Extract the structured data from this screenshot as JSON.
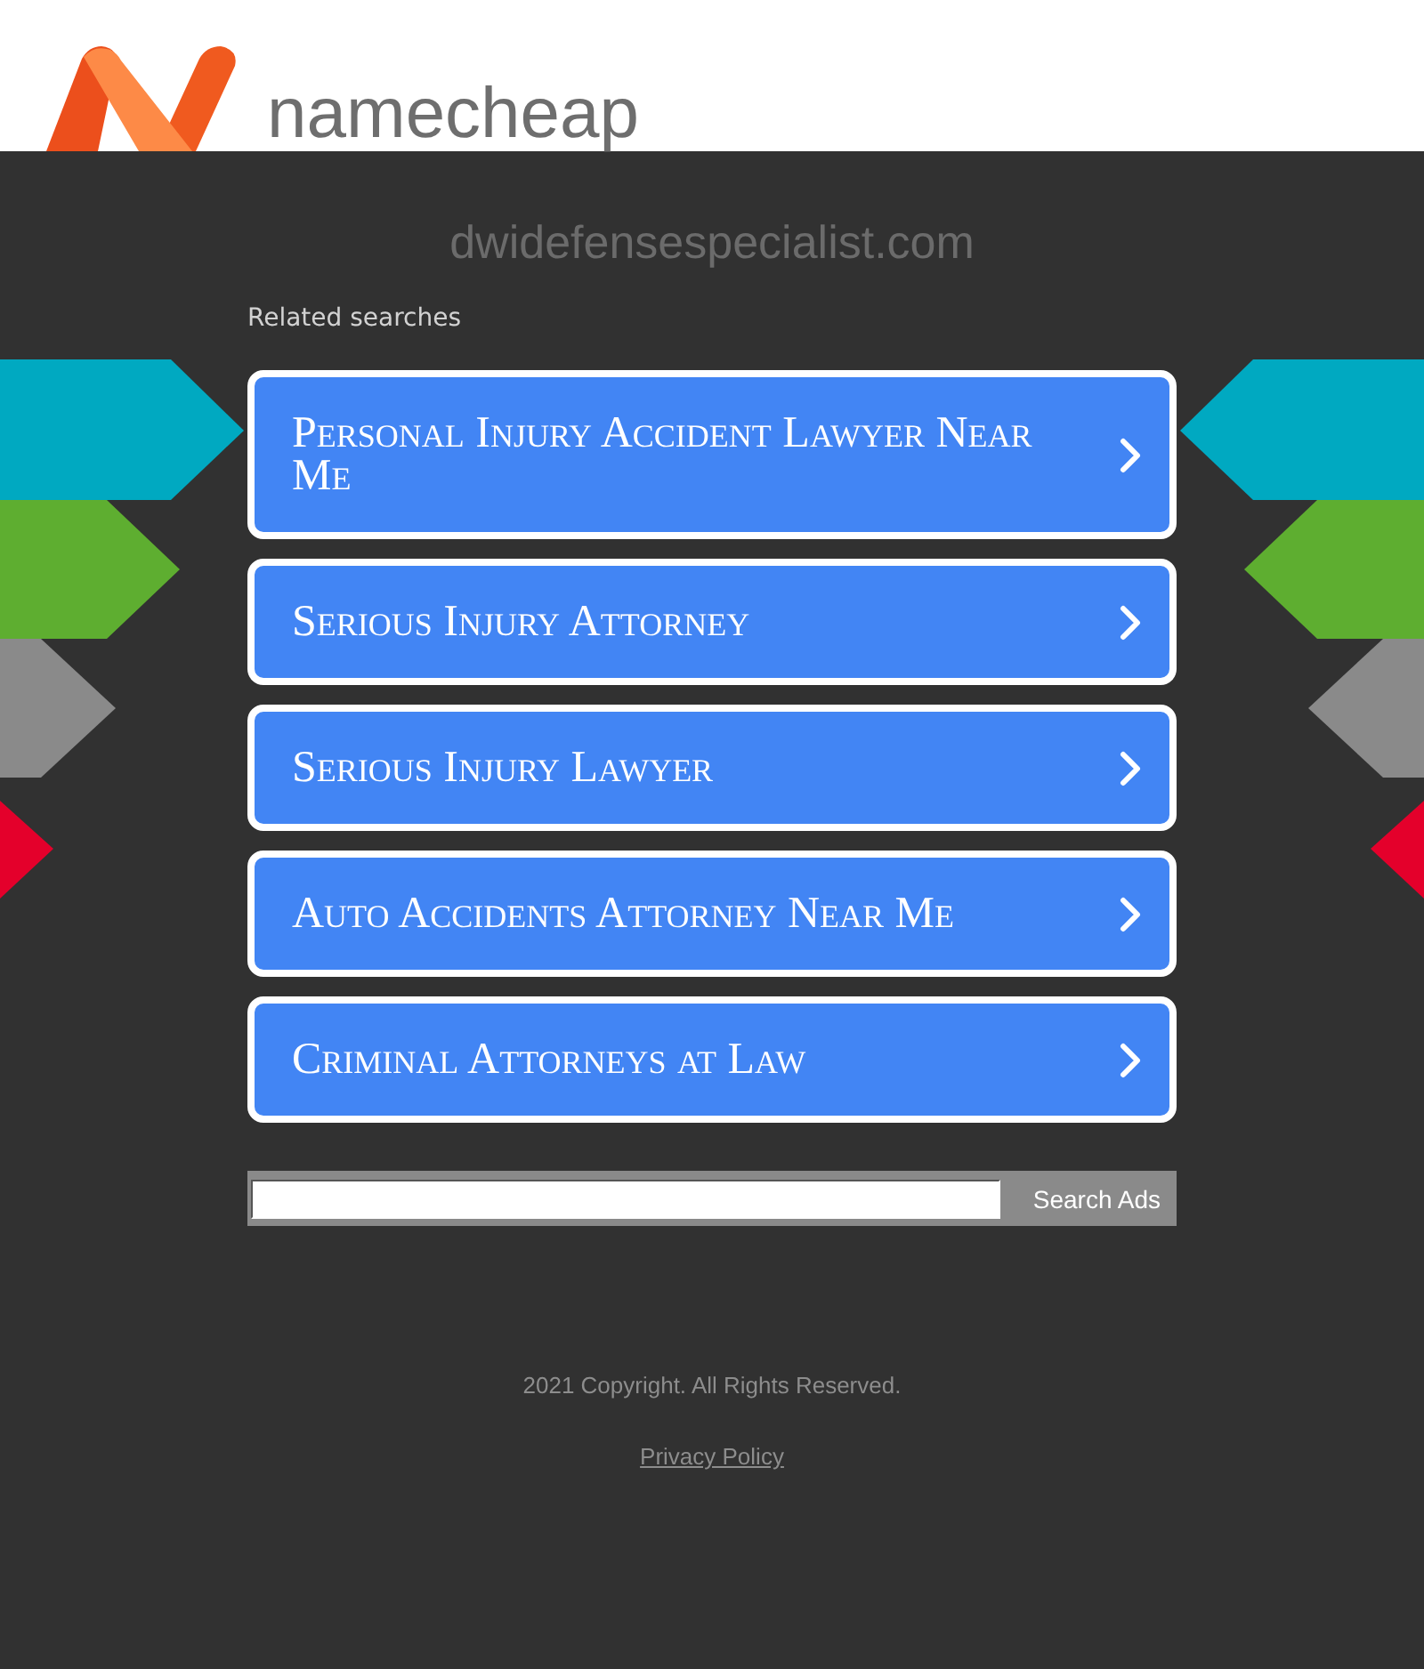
{
  "header": {
    "logo_text": "namecheap"
  },
  "domain": "dwidefensespecialist.com",
  "related_searches": {
    "heading": "Related searches",
    "links": [
      {
        "label": "Personal Injury Accident Lawyer Near Me"
      },
      {
        "label": "Serious Injury Attorney"
      },
      {
        "label": "Serious Injury Lawyer"
      },
      {
        "label": "Auto Accidents Attorney Near Me"
      },
      {
        "label": "Criminal Attorneys at Law"
      }
    ]
  },
  "search": {
    "button": "Search Ads"
  },
  "footer": {
    "copyright": "2021 Copyright. All Rights Reserved.",
    "privacy_link": "Privacy Policy"
  }
}
